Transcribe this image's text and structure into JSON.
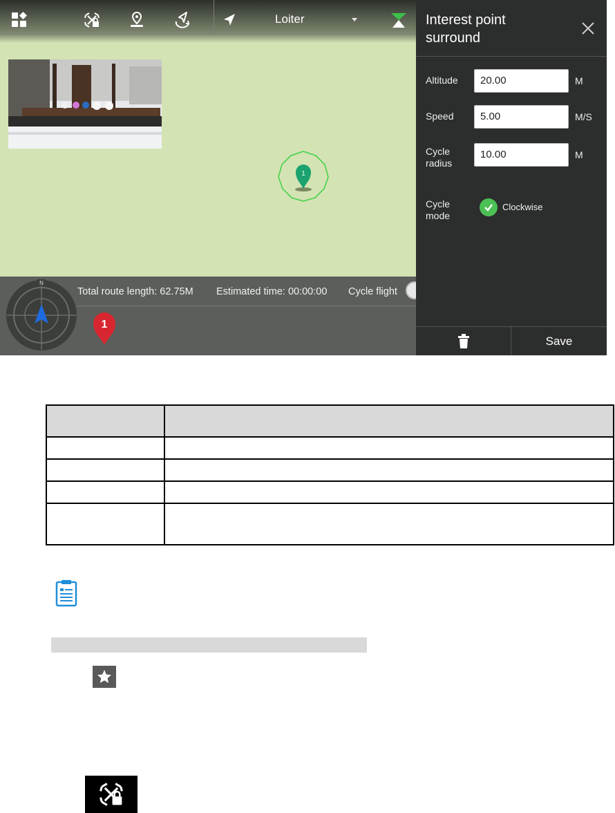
{
  "toolbar": {
    "mode": "Loiter",
    "icons": [
      "dashboard-icon",
      "drone-lock-icon",
      "location-pin-icon",
      "takeoff-icon",
      "navigation-arrow-icon",
      "signal-icon"
    ]
  },
  "map": {
    "poi_marker_label": "1",
    "route_marker_label": "1",
    "compass_label": "N"
  },
  "status": {
    "route_length": "Total route length: 62.75M",
    "estimated_time": "Estimated time: 00:00:00",
    "cycle_flight": "Cycle flight"
  },
  "panel": {
    "title": "Interest point surround",
    "fields": [
      {
        "label": "Altitude",
        "value": "20.00",
        "unit": "M"
      },
      {
        "label": "Speed",
        "value": "5.00",
        "unit": "M/S"
      },
      {
        "label": "Cycle radius",
        "value": "10.00",
        "unit": "M"
      }
    ],
    "cycle_mode_label": "Cycle mode",
    "cycle_mode_value": "Clockwise",
    "save_label": "Save"
  },
  "doc_table": {
    "rows": [
      [
        "",
        ""
      ],
      [
        "",
        ""
      ],
      [
        "",
        ""
      ],
      [
        "",
        ""
      ],
      [
        "",
        ""
      ]
    ]
  },
  "colors": {
    "map_bg": "#d3e3b4",
    "panel_bg": "#2c2d2d",
    "accent_green": "#4cc055",
    "route_marker_red": "#d7262f",
    "poi_green": "#1aa36f"
  }
}
